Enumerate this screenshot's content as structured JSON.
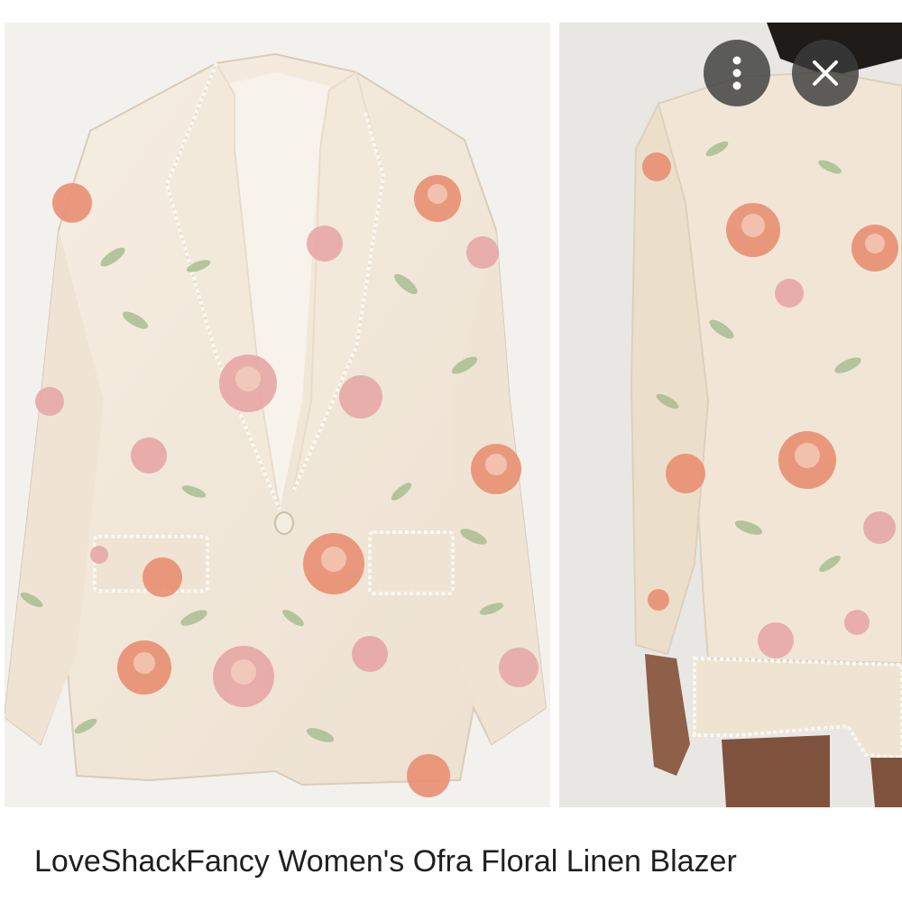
{
  "product": {
    "title": "LoveShackFancy Women's Ofra Floral Linen Blazer"
  },
  "images": [
    {
      "view": "front",
      "icon": "blazer-front-image"
    },
    {
      "view": "back",
      "icon": "blazer-back-image"
    }
  ],
  "controls": {
    "more_icon": "more-vert-icon",
    "close_icon": "close-icon"
  },
  "colors": {
    "fabric": "#f1e7d8",
    "rose": "#e98f72",
    "pink": "#e7a7a6",
    "leaf": "#9fb889",
    "overlay": "#3c3c3c"
  }
}
